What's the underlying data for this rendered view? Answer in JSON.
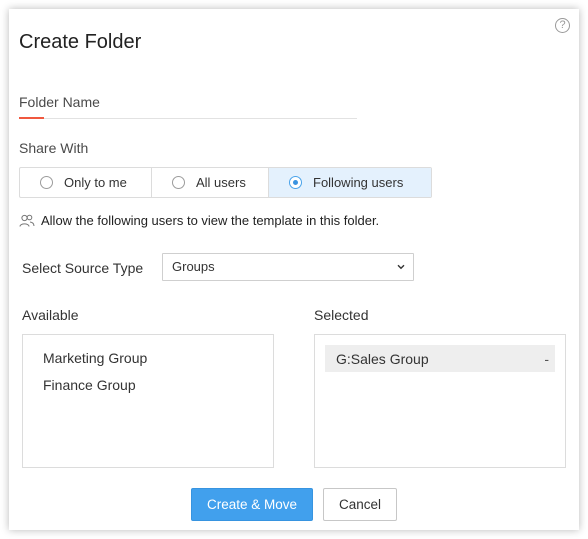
{
  "dialog": {
    "title": "Create Folder",
    "help_icon": "?"
  },
  "folder_name": {
    "placeholder": "Folder Name",
    "value": ""
  },
  "share_with": {
    "label": "Share With",
    "options": [
      {
        "label": "Only to me",
        "selected": false
      },
      {
        "label": "All users",
        "selected": false
      },
      {
        "label": "Following users",
        "selected": true
      }
    ]
  },
  "info": {
    "icon": "users-icon",
    "text": "Allow the following users to view the template in this folder."
  },
  "source_type": {
    "label": "Select Source Type",
    "value": "Groups"
  },
  "available": {
    "label": "Available",
    "items": [
      "Marketing Group",
      "Finance Group"
    ]
  },
  "selected": {
    "label": "Selected",
    "items": [
      {
        "label": "G:Sales Group",
        "remove": "-"
      }
    ]
  },
  "buttons": {
    "primary": "Create & Move",
    "cancel": "Cancel"
  },
  "colors": {
    "accent_blue": "#41a0ed",
    "selected_option_bg": "#e4f1fd",
    "input_accent": "#f0583f"
  }
}
